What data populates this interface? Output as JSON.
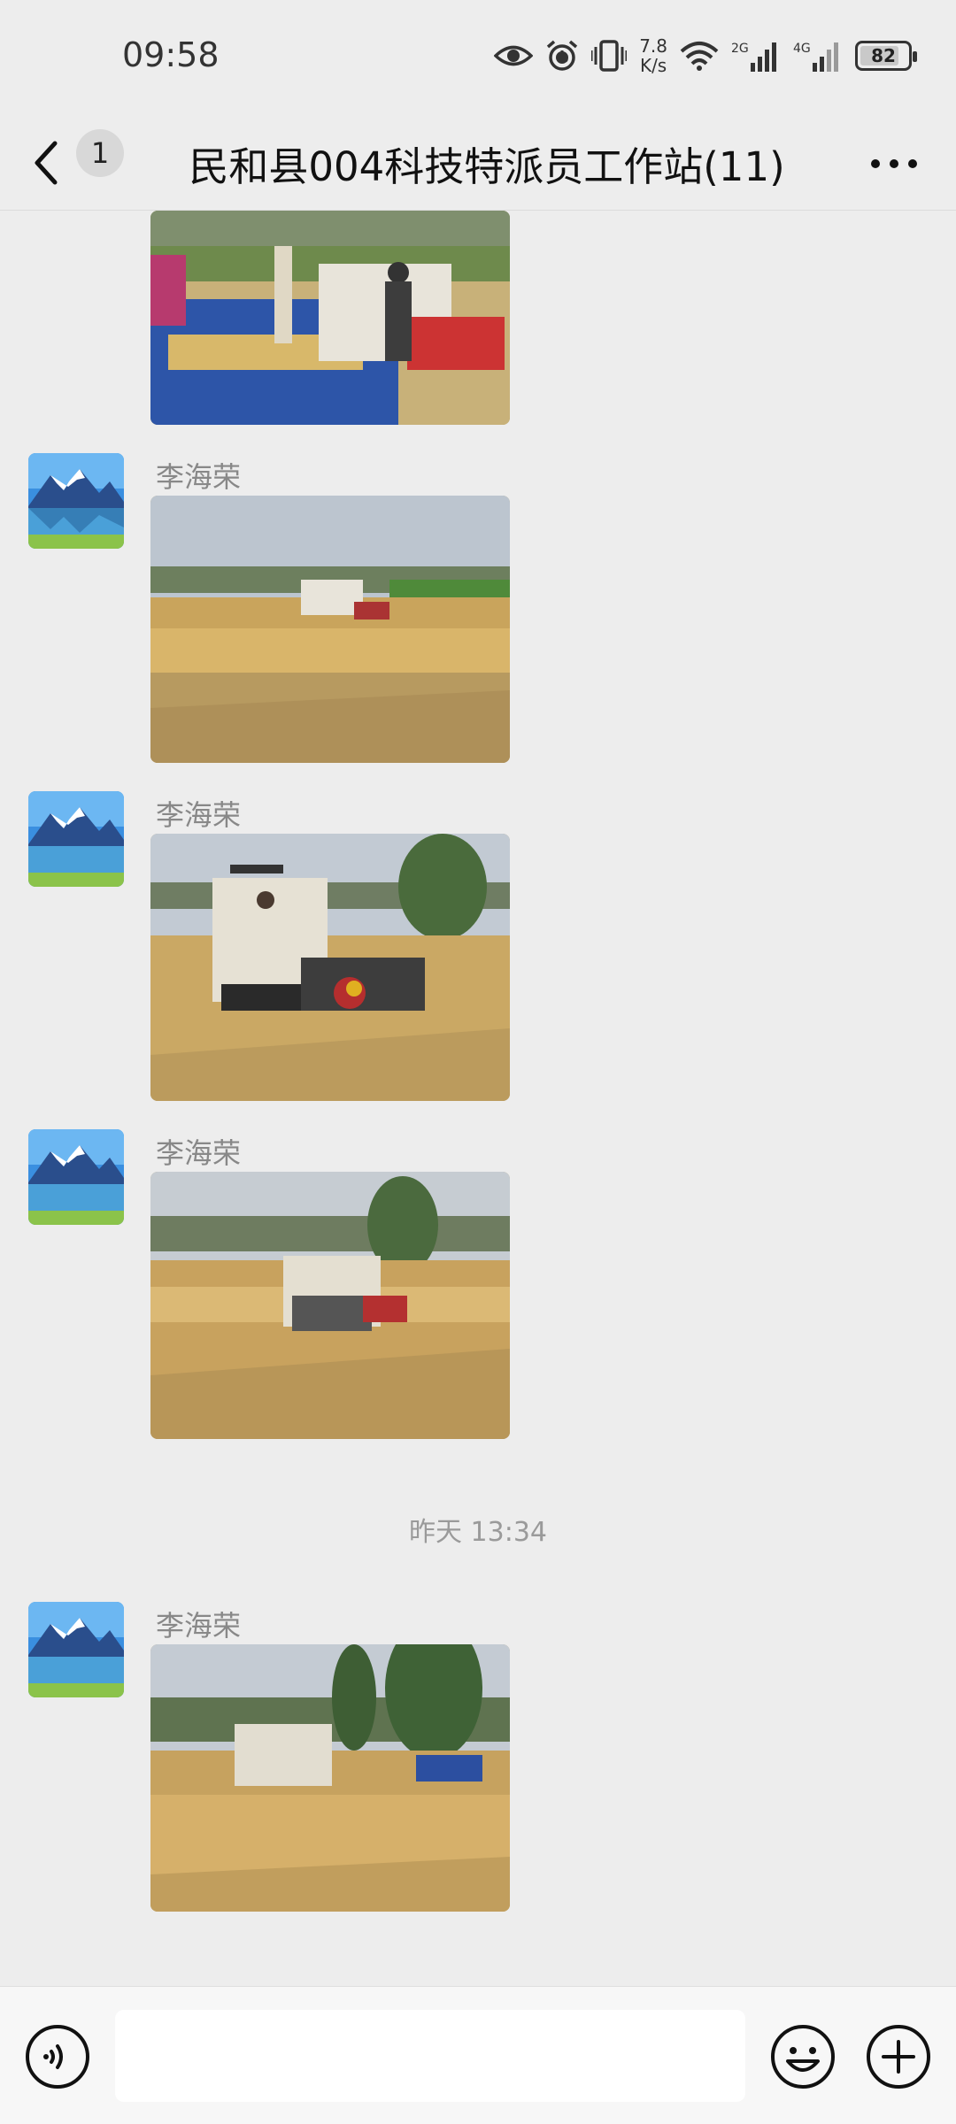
{
  "status_bar": {
    "time": "09:58",
    "net_speed_value": "7.8",
    "net_speed_unit": "K/s",
    "sim1_label": "2G",
    "sim2_label": "4G",
    "battery": "82",
    "battery_level": 0.82
  },
  "header": {
    "unread_count": "1",
    "title": "民和县004科技特派员工作站(11)"
  },
  "messages": [
    {
      "type": "image",
      "sender": "",
      "photo": "harvest-grain-unloading-truck",
      "caption": ""
    },
    {
      "type": "image",
      "sender": "李海荣",
      "photo": "combine-harvester-distant-wheat-field"
    },
    {
      "type": "image",
      "sender": "李海荣",
      "photo": "combine-harvester-front-view"
    },
    {
      "type": "image",
      "sender": "李海荣",
      "photo": "combine-harvester-harvesting"
    },
    {
      "type": "time",
      "text": "昨天 13:34"
    },
    {
      "type": "image",
      "sender": "李海荣",
      "photo": "harvester-and-blue-truck"
    }
  ],
  "input_bar": {
    "placeholder": "",
    "icons": [
      "voice-icon",
      "emoji-icon",
      "plus-icon"
    ]
  },
  "colors": {
    "background": "#ededed",
    "input_bar": "#f7f7f7",
    "sender_name": "#888888",
    "wheat": "#c9a45c",
    "sky": "#b8c3cf"
  }
}
